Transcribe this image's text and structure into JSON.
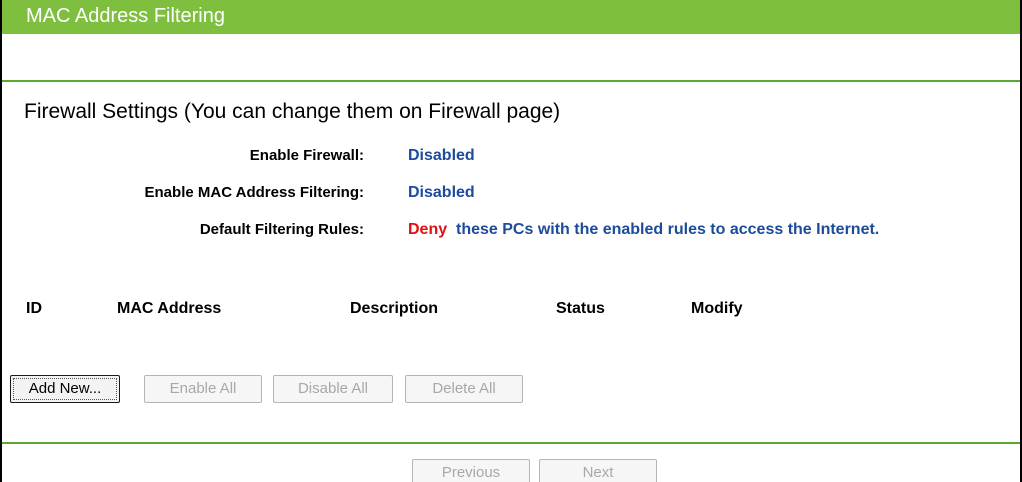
{
  "header": {
    "title": "MAC Address Filtering",
    "accent_color": "#7fbf3f"
  },
  "firewall": {
    "section_title": "Firewall Settings (You can change them on Firewall page)",
    "enable_firewall_label": "Enable Firewall:",
    "enable_firewall_value": "Disabled",
    "enable_mac_label": "Enable MAC Address Filtering:",
    "enable_mac_value": "Disabled",
    "default_rules_label": "Default Filtering Rules:",
    "default_rules_action": "Deny",
    "default_rules_text": "these PCs with the enabled rules to access the Internet.",
    "value_color": "#1d4b9c",
    "deny_color": "#e01010"
  },
  "table": {
    "columns": [
      "ID",
      "MAC Address",
      "Description",
      "Status",
      "Modify"
    ],
    "rows": []
  },
  "actions": {
    "add_new": "Add New...",
    "enable_all": "Enable All",
    "disable_all": "Disable All",
    "delete_all": "Delete All"
  },
  "pagination": {
    "previous": "Previous",
    "next": "Next"
  }
}
